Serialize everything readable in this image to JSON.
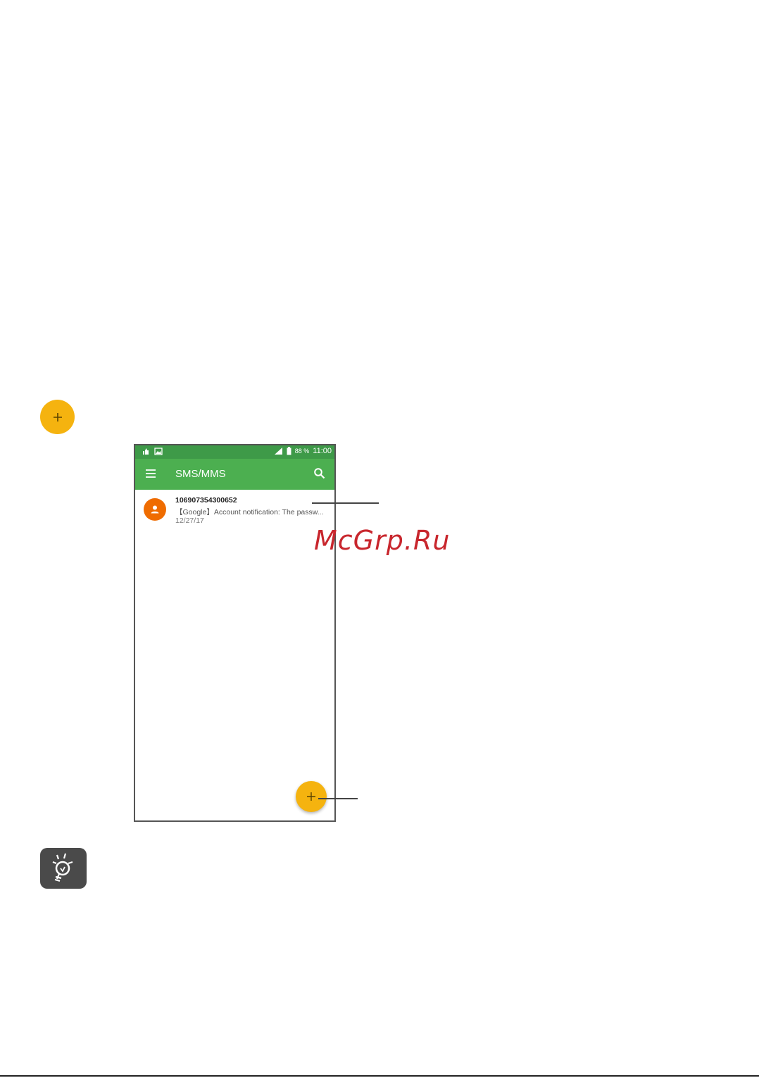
{
  "phone": {
    "status_bar": {
      "battery_percent": "88 %",
      "time": "11:00"
    },
    "toolbar": {
      "title": "SMS/MMS"
    },
    "conversations": [
      {
        "sender": "106907354300652",
        "snippet": "【Google】Account notification: The passw...",
        "date": "12/27/17"
      }
    ]
  },
  "watermark": "McGrp.Ru",
  "colors": {
    "fab": "#f5b30f",
    "toolbar": "#4caf50",
    "status_bar": "#3e9a48",
    "avatar": "#ef6c00",
    "watermark": "#c8262d"
  },
  "icons": {
    "inline_fab": "plus-icon",
    "menu": "hamburger-menu-icon",
    "search": "search-icon",
    "avatar": "person-icon",
    "compose": "plus-icon",
    "tip": "lightbulb-tip-icon"
  }
}
